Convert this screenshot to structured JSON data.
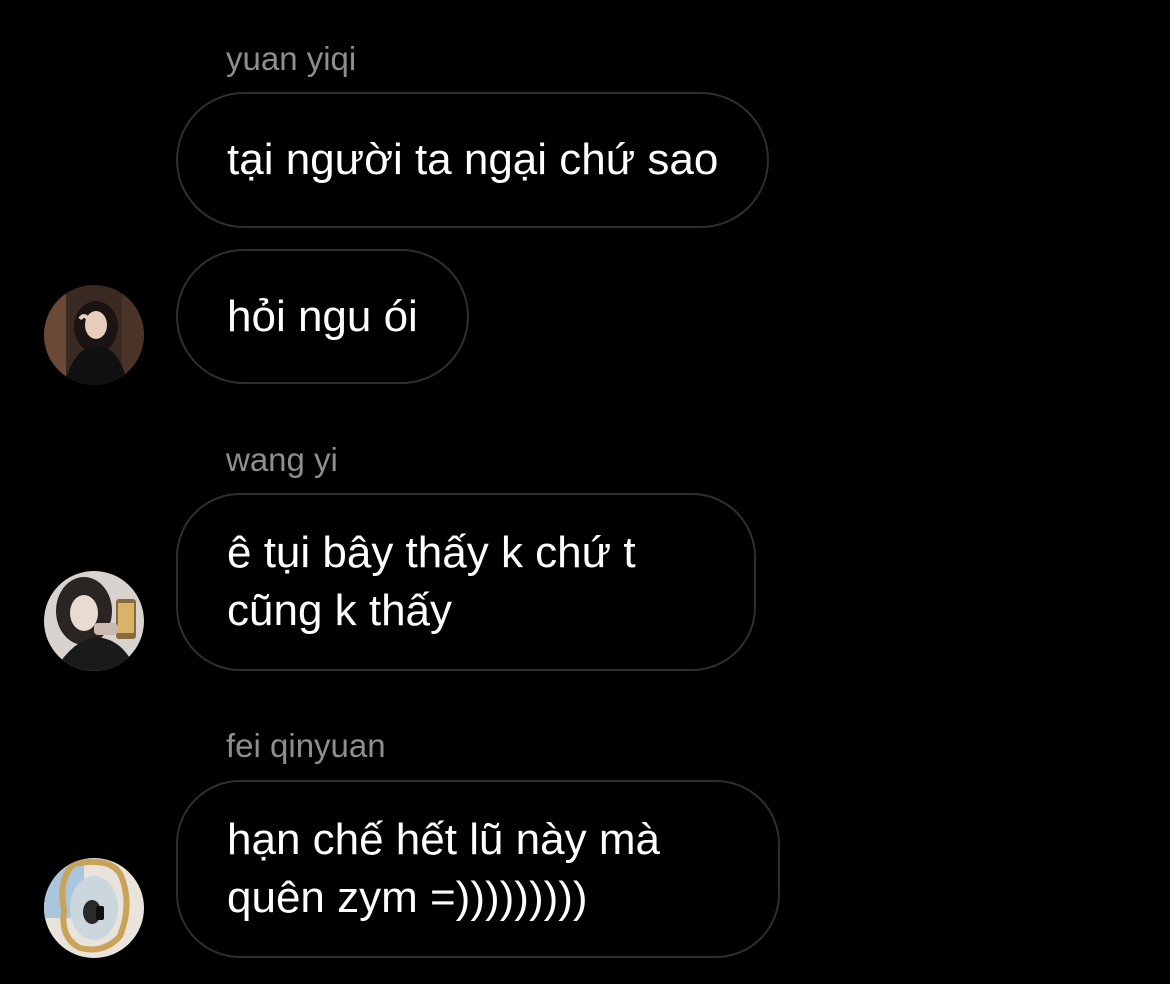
{
  "conversation": {
    "groups": [
      {
        "sender": "yuan yiqi",
        "messages": [
          "tại người ta ngại chứ sao",
          "hỏi ngu ói"
        ],
        "avatar_icon": "profile-photo"
      },
      {
        "sender": "wang yi",
        "messages": [
          "ê tụi bây thấy k chứ t cũng k thấy"
        ],
        "avatar_icon": "profile-photo"
      },
      {
        "sender": "fei qinyuan",
        "messages": [
          "hạn chế hết lũ này mà quên zym =)))))))))"
        ],
        "avatar_icon": "profile-photo"
      }
    ]
  },
  "colors": {
    "background": "#000000",
    "bubble_border": "#2f2f2f",
    "sender_name": "#8e8e8e",
    "message_text": "#ffffff"
  }
}
